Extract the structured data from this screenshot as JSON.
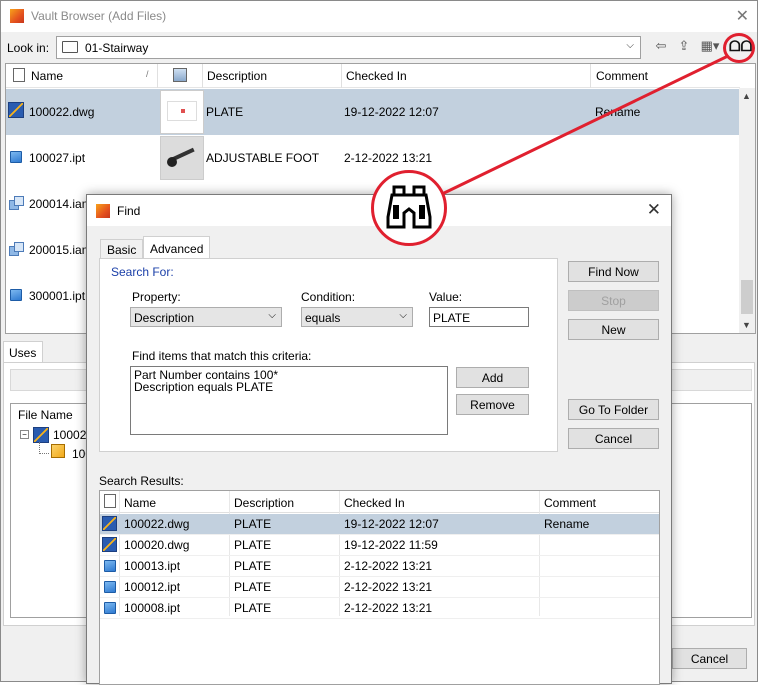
{
  "window": {
    "title": "Vault Browser (Add Files)"
  },
  "look_in": {
    "label": "Look in:",
    "value": "01-Stairway"
  },
  "columns": {
    "name": "Name",
    "description": "Description",
    "checked_in": "Checked In",
    "comment": "Comment"
  },
  "files": [
    {
      "name": "100022.dwg",
      "icon": "dwg-icon",
      "description": "PLATE",
      "checked_in": "19-12-2022 12:07",
      "comment": "Rename",
      "selected": true
    },
    {
      "name": "100027.ipt",
      "icon": "ipt-icon",
      "description": "ADJUSTABLE FOOT",
      "checked_in": "2-12-2022 13:21",
      "comment": ""
    },
    {
      "name": "200014.iam",
      "icon": "iam-icon",
      "description": "",
      "checked_in": "",
      "comment": ""
    },
    {
      "name": "200015.iam",
      "icon": "iam-icon",
      "description": "",
      "checked_in": "",
      "comment": ""
    },
    {
      "name": "300001.ipt",
      "icon": "ipt-icon",
      "description": "",
      "checked_in": "",
      "comment": ""
    }
  ],
  "lower": {
    "uses_tab": "Uses",
    "file_name_header": "File Name",
    "tree": [
      {
        "name": "100022"
      },
      {
        "name": "100"
      }
    ],
    "cancel": "Cancel"
  },
  "find": {
    "title": "Find",
    "tabs": [
      "Basic",
      "Advanced"
    ],
    "search_for": "Search For:",
    "property_label": "Property:",
    "property_value": "Description",
    "condition_label": "Condition:",
    "condition_value": "equals",
    "value_label": "Value:",
    "value": "PLATE",
    "criteria_label": "Find items that match this criteria:",
    "criteria": [
      "Part Number contains 100*",
      "Description equals PLATE"
    ],
    "buttons": {
      "find_now": "Find Now",
      "stop": "Stop",
      "new": "New",
      "add": "Add",
      "remove": "Remove",
      "go_to_folder": "Go To Folder",
      "cancel": "Cancel"
    },
    "results_label": "Search Results:",
    "results_columns": {
      "name": "Name",
      "description": "Description",
      "checked_in": "Checked In",
      "comment": "Comment"
    },
    "results": [
      {
        "name": "100022.dwg",
        "icon": "dwg-icon",
        "description": "PLATE",
        "checked_in": "19-12-2022 12:07",
        "comment": "Rename",
        "selected": true
      },
      {
        "name": "100020.dwg",
        "icon": "dwg-icon",
        "description": "PLATE",
        "checked_in": "19-12-2022 11:59",
        "comment": ""
      },
      {
        "name": "100013.ipt",
        "icon": "ipt-icon",
        "description": "PLATE",
        "checked_in": "2-12-2022 13:21",
        "comment": ""
      },
      {
        "name": "100012.ipt",
        "icon": "ipt-icon",
        "description": "PLATE",
        "checked_in": "2-12-2022 13:21",
        "comment": ""
      },
      {
        "name": "100008.ipt",
        "icon": "ipt-icon",
        "description": "PLATE",
        "checked_in": "2-12-2022 13:21",
        "comment": ""
      }
    ]
  },
  "colors": {
    "selection": "#c2d0de",
    "callout": "#e0202f",
    "link_blue": "#1a3fa8"
  }
}
